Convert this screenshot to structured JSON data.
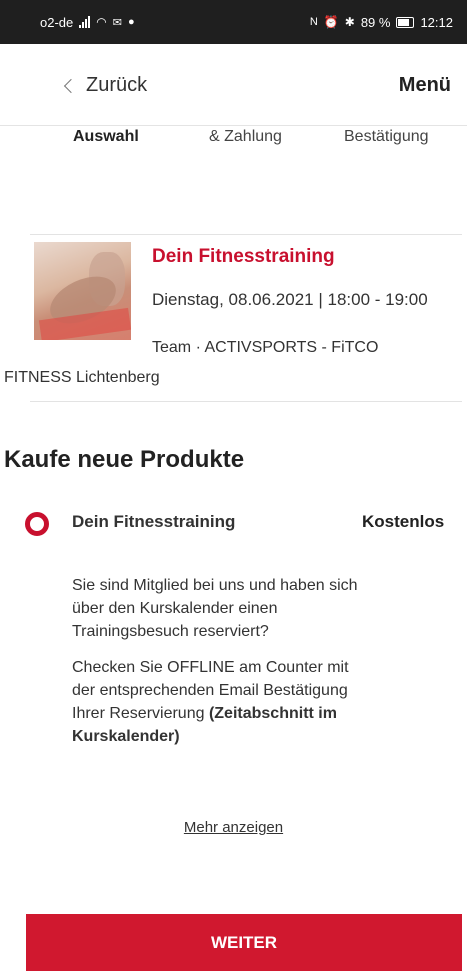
{
  "status_bar": {
    "carrier": "o2-de",
    "battery": "89 %",
    "time": "12:12"
  },
  "header": {
    "back_label": "Zurück",
    "menu_label": "Menü"
  },
  "steps": [
    "Auswahl",
    "& Zahlung",
    "Bestätigung"
  ],
  "booking": {
    "title": "Dein Fitnesstraining",
    "date_time": "Dienstag, 08.06.2021 | 18:00 - 19:00",
    "team": "Team · ACTIVSPORTS - FiTCO",
    "studio": "FITNESS Lichtenberg"
  },
  "section_title": "Kaufe neue Produkte",
  "product": {
    "name": "Dein Fitnesstraining",
    "price": "Kostenlos",
    "description_1": "Sie sind Mitglied bei uns und haben sich über den Kurskalender einen Trainingsbesuch reserviert?",
    "description_2": "Checken Sie OFFLINE am Counter mit der entsprechenden Email Bestätigung Ihrer Reservierung ",
    "description_2_bold": "(Zeitabschnitt im Kurskalender)"
  },
  "show_more": "Mehr anzeigen",
  "continue_button": "WEITER",
  "colors": {
    "accent": "#c8102e",
    "button": "#d0182f",
    "status_bar": "#1f1f1f"
  }
}
